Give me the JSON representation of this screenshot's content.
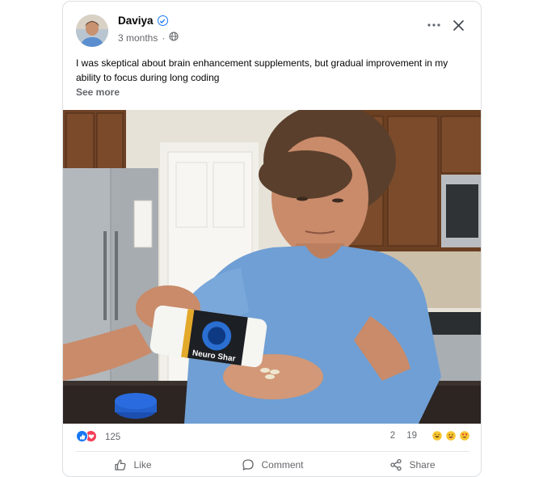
{
  "post": {
    "author": "Daviya",
    "verified_icon": "verified-badge-icon",
    "time": "3 months",
    "separator": "·",
    "audience_icon": "globe-icon",
    "text": "I was skeptical about brain enhancement supplements, but gradual improvement in my ability to focus during long coding",
    "see_more": "See more",
    "product_label": "Neuro Shar"
  },
  "stats": {
    "reaction_count": "125",
    "comments": "2",
    "shares": "19",
    "reaction_icons": [
      "like-icon",
      "love-icon"
    ],
    "emoji_icons": [
      "laugh-emoji-icon",
      "wow-emoji-icon",
      "heart-eyes-emoji-icon"
    ]
  },
  "actions": {
    "like": "Like",
    "comment": "Comment",
    "share": "Share"
  },
  "colors": {
    "accent": "#1877f2",
    "love": "#f33e58",
    "muted": "#65676b",
    "shirt": "#6f9fd4"
  }
}
